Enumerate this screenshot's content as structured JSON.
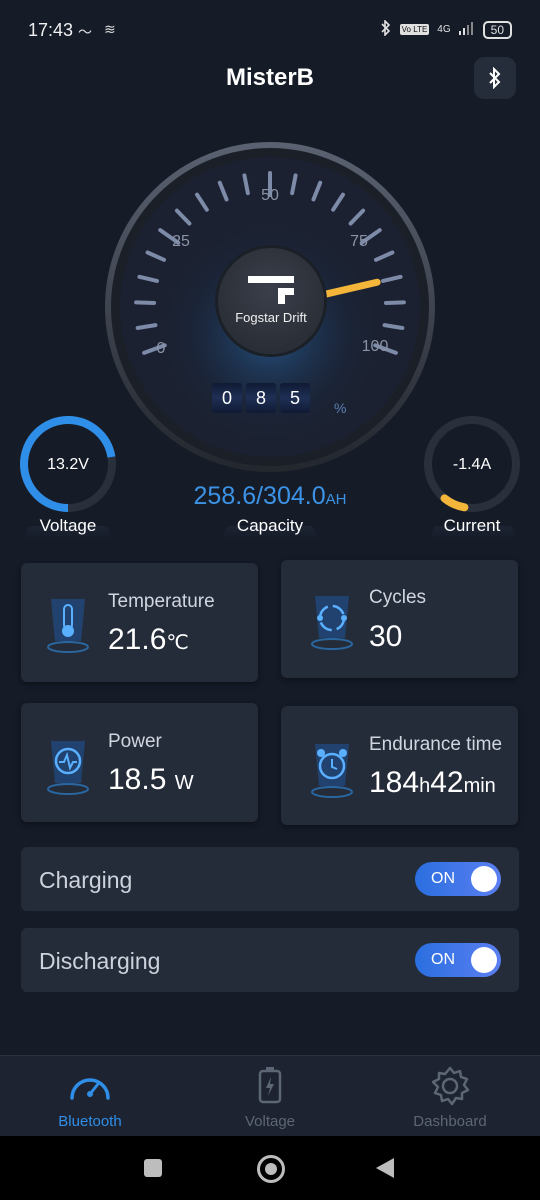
{
  "status_bar": {
    "time": "17:43",
    "network": "4G",
    "volte": "Vo LTE",
    "battery": "50"
  },
  "header": {
    "title": "MisterB"
  },
  "gauge": {
    "ticks": [
      "0",
      "25",
      "50",
      "75",
      "100"
    ],
    "device_name": "Fogstar Drift",
    "percent_digits": [
      "0",
      "8",
      "5"
    ],
    "percent_unit": "%",
    "percent": 85,
    "needle_color": "#f3b53a"
  },
  "voltage": {
    "value": "13.2V",
    "label": "Voltage",
    "ring_color": "#2f8fe8"
  },
  "capacity": {
    "value": "258.6/304.0",
    "unit": "AH",
    "label": "Capacity"
  },
  "current": {
    "value": "-1.4A",
    "label": "Current",
    "ring_color": "#f3b53a"
  },
  "cards": {
    "temperature": {
      "label": "Temperature",
      "value": "21.6",
      "unit": "℃"
    },
    "cycles": {
      "label": "Cycles",
      "value": "30"
    },
    "power": {
      "label": "Power",
      "value": "18.5",
      "unit": "W"
    },
    "endurance": {
      "label": "Endurance time",
      "hours": "184",
      "h_unit": "h",
      "minutes": "42",
      "m_unit": "min"
    }
  },
  "toggles": {
    "charging": {
      "label": "Charging",
      "state": "ON"
    },
    "discharging": {
      "label": "Discharging",
      "state": "ON"
    }
  },
  "bottom_nav": {
    "items": [
      {
        "label": "Bluetooth",
        "icon": "speedometer-icon",
        "active": true
      },
      {
        "label": "Voltage",
        "icon": "battery-icon",
        "active": false
      },
      {
        "label": "Dashboard",
        "icon": "gear-icon",
        "active": false
      }
    ],
    "active_color": "#2f8fe8",
    "inactive_color": "#5d6675"
  }
}
